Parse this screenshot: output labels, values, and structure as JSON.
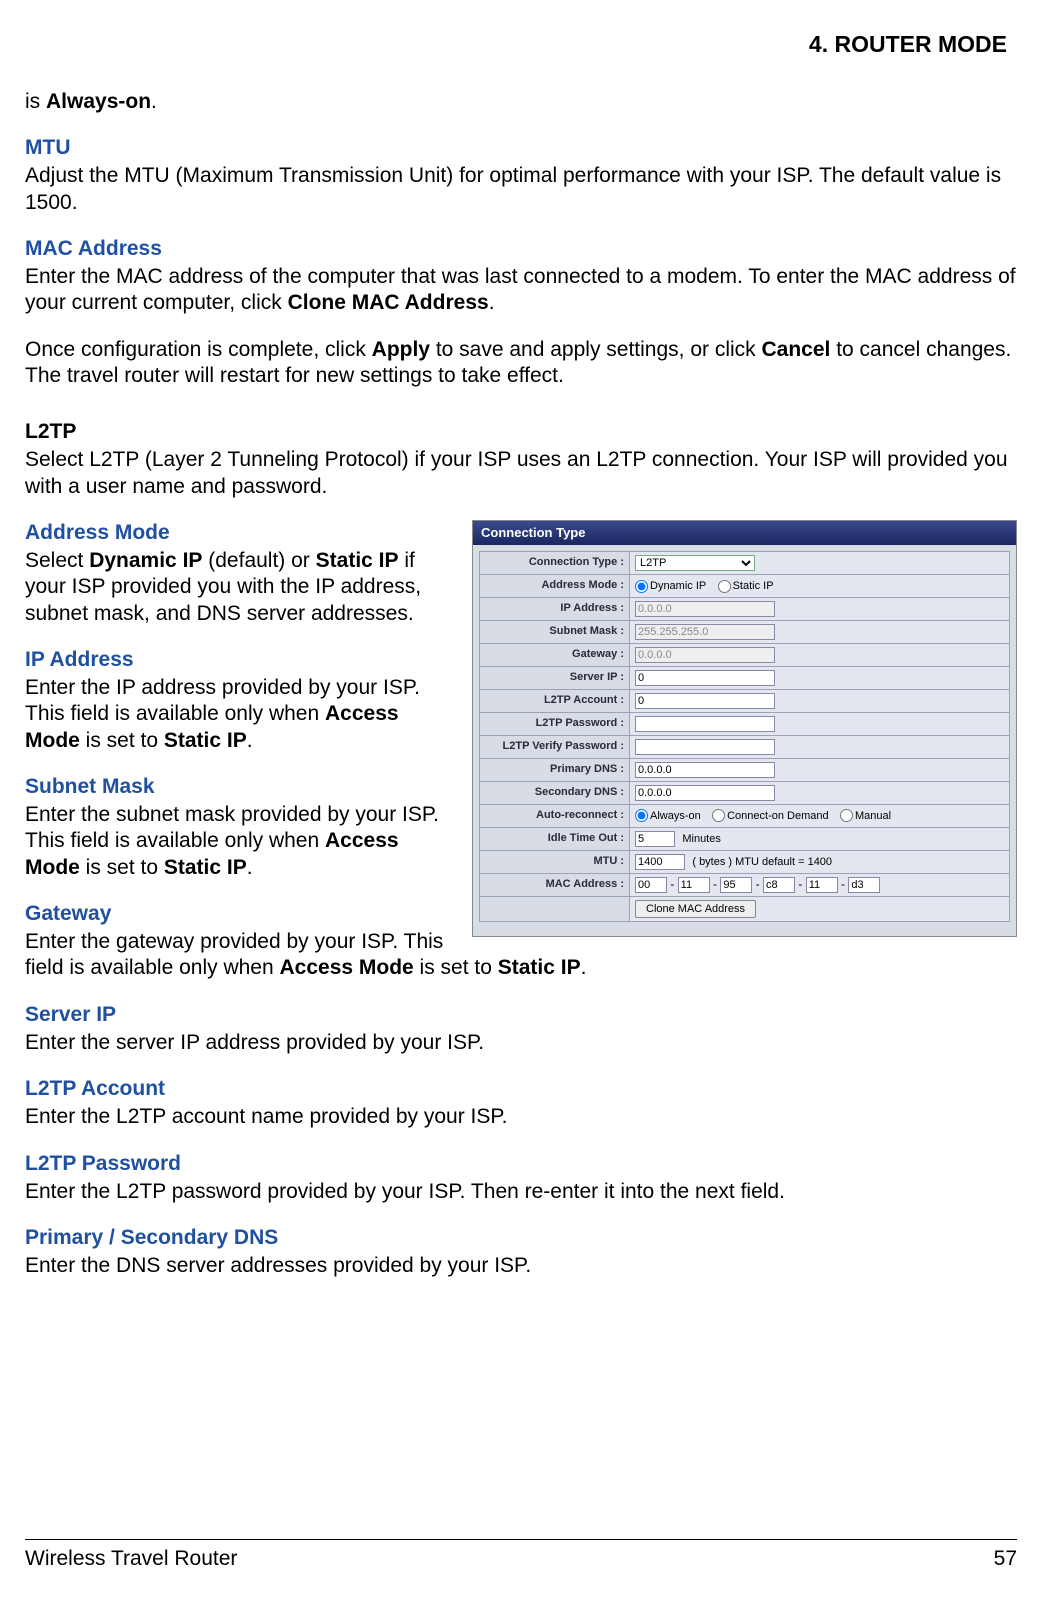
{
  "chapter": "4.  ROUTER MODE",
  "intro": {
    "prefix": "is ",
    "bold": "Always-on",
    "suffix": "."
  },
  "mtu": {
    "head": "MTU",
    "body": "Adjust the MTU (Maximum Transmission Unit) for optimal performance with your ISP. The default value is 1500."
  },
  "mac": {
    "head": "MAC Address",
    "l1a": "Enter the MAC address of the computer that was last connected to a modem. To enter the MAC address of your current computer, click ",
    "l1b": "Clone MAC Address",
    "l1c": "."
  },
  "apply": {
    "a": "Once configuration is complete, click ",
    "b": "Apply",
    "c": " to save and apply settings, or click ",
    "d": "Cancel",
    "e": " to cancel changes. The travel router will restart for new settings to take effect."
  },
  "l2tp": {
    "head": "L2TP",
    "body": "Select L2TP (Layer 2 Tunneling Protocol) if your ISP uses an L2TP connection. Your ISP will provided you with a user name and password."
  },
  "addrmode": {
    "head": "Address Mode",
    "a": "Select ",
    "b": "Dynamic IP",
    "c": " (default) or ",
    "d": "Static IP",
    "e": " if your ISP provided you with the IP address, subnet mask, and DNS server addresses."
  },
  "ipaddr": {
    "head": "IP Address",
    "a": "Enter the IP address provided by your ISP. This field is available only when ",
    "b": "Access Mode",
    "c": " is set to ",
    "d": "Static IP",
    "e": "."
  },
  "subnet": {
    "head": "Subnet Mask",
    "a": "Enter the subnet mask provided by your ISP. This field is available only when ",
    "b": "Access Mode",
    "c": " is set to ",
    "d": "Static IP",
    "e": "."
  },
  "gateway": {
    "head": "Gateway",
    "a": "Enter the gateway provided by your ISP. This field is available only when ",
    "b": "Access Mode",
    "c": " is set to ",
    "d": "Static IP",
    "e": "."
  },
  "serverip": {
    "head": "Server IP",
    "body": "Enter the server IP address provided by your ISP."
  },
  "l2tpacct": {
    "head": "L2TP Account",
    "body": "Enter the L2TP account name provided by your ISP."
  },
  "l2tppwd": {
    "head": "L2TP Password",
    "body": "Enter the L2TP password provided by your ISP. Then re-enter it into the next field."
  },
  "dns": {
    "head": "Primary / Secondary DNS",
    "body": "Enter the DNS server addresses provided by your ISP."
  },
  "figure": {
    "title": "Connection Type",
    "rows": {
      "conn_type": {
        "label": "Connection Type :",
        "value": "L2TP"
      },
      "addr_mode": {
        "label": "Address Mode :",
        "opt1": "Dynamic IP",
        "opt2": "Static IP"
      },
      "ip": {
        "label": "IP Address :",
        "value": "0.0.0.0"
      },
      "mask": {
        "label": "Subnet Mask :",
        "value": "255.255.255.0"
      },
      "gw": {
        "label": "Gateway :",
        "value": "0.0.0.0"
      },
      "srv": {
        "label": "Server IP :",
        "value": "0"
      },
      "acct": {
        "label": "L2TP Account :",
        "value": "0"
      },
      "pwd": {
        "label": "L2TP Password :",
        "value": ""
      },
      "vpwd": {
        "label": "L2TP Verify Password :",
        "value": ""
      },
      "pdns": {
        "label": "Primary DNS :",
        "value": "0.0.0.0"
      },
      "sdns": {
        "label": "Secondary DNS :",
        "value": "0.0.0.0"
      },
      "auto": {
        "label": "Auto-reconnect :",
        "o1": "Always-on",
        "o2": "Connect-on Demand",
        "o3": "Manual"
      },
      "idle": {
        "label": "Idle Time Out :",
        "value": "5",
        "unit": "Minutes"
      },
      "mtu": {
        "label": "MTU :",
        "value": "1400",
        "note": "( bytes ) MTU default = 1400"
      },
      "macaddr": {
        "label": "MAC Address :",
        "o1": "00",
        "o2": "11",
        "o3": "95",
        "o4": "c8",
        "o5": "11",
        "o6": "d3",
        "btn": "Clone MAC Address"
      }
    }
  },
  "footer": {
    "left": "Wireless Travel Router",
    "right": "57"
  }
}
